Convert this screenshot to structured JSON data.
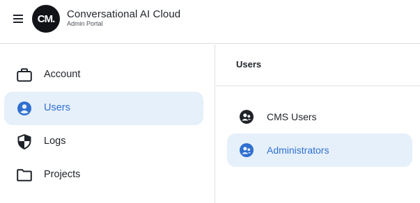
{
  "header": {
    "logo_text": "CM.",
    "title": "Conversational AI Cloud",
    "subtitle": "Admin Portal"
  },
  "sidebar": {
    "items": [
      {
        "label": "Account",
        "icon": "briefcase-icon",
        "active": false
      },
      {
        "label": "Users",
        "icon": "user-circle-icon",
        "active": true
      },
      {
        "label": "Logs",
        "icon": "shield-icon",
        "active": false
      },
      {
        "label": "Projects",
        "icon": "folder-icon",
        "active": false
      }
    ]
  },
  "panel": {
    "title": "Users",
    "items": [
      {
        "label": "CMS Users",
        "icon": "users-group-icon",
        "active": false
      },
      {
        "label": "Administrators",
        "icon": "users-group-icon",
        "active": true
      }
    ]
  },
  "colors": {
    "accent": "#2f6fd0",
    "active_bg": "#e6f0fb",
    "text": "#1f2329",
    "divider": "#dcdfe4"
  }
}
